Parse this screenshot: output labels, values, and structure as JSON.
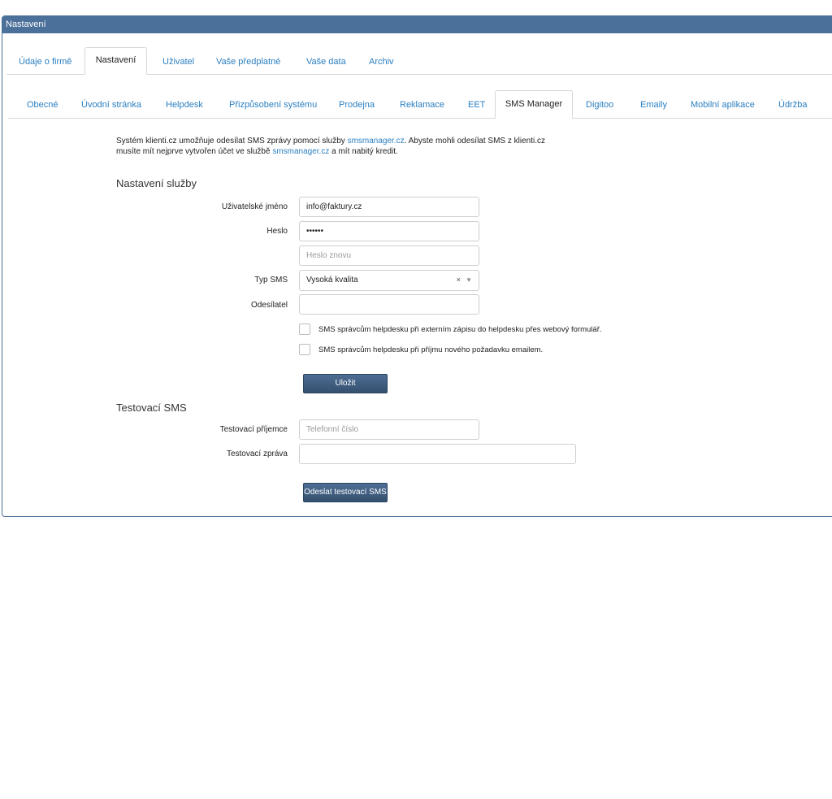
{
  "window": {
    "title": "Nastavení"
  },
  "main_tabs": [
    {
      "label": "Údaje o firmě"
    },
    {
      "label": "Nastavení"
    },
    {
      "label": "Uživatel"
    },
    {
      "label": "Vaše předplatné"
    },
    {
      "label": "Vaše data"
    },
    {
      "label": "Archiv"
    }
  ],
  "sub_tabs": [
    {
      "label": "Obecné"
    },
    {
      "label": "Úvodní stránka"
    },
    {
      "label": "Helpdesk"
    },
    {
      "label": "Přizpůsobení systému"
    },
    {
      "label": "Prodejna"
    },
    {
      "label": "Reklamace"
    },
    {
      "label": "EET"
    },
    {
      "label": "SMS Manager"
    },
    {
      "label": "Digitoo"
    },
    {
      "label": "Emaily"
    },
    {
      "label": "Mobilní aplikace"
    },
    {
      "label": "Údržba"
    }
  ],
  "intro": {
    "part1": "Systém klienti.cz umožňuje odesílat SMS zprávy pomocí služby ",
    "link1": "smsmanager.cz",
    "part2": ". Abyste mohli odesílat SMS z klienti.cz",
    "part3": "musíte mít nejprve vytvořen účet ve službě ",
    "link2": "smsmanager.cz",
    "part4": " a mít nabitý kredit."
  },
  "service": {
    "title": "Nastavení služby",
    "username_label": "Uživatelské jméno",
    "username_value": "info@faktury.cz",
    "password_label": "Heslo",
    "password_value": "••••••",
    "password_again_placeholder": "Heslo znovu",
    "type_label": "Typ SMS",
    "type_value": "Vysoká kvalita",
    "type_clear": "×",
    "type_caret": "▼",
    "sender_label": "Odesílatel",
    "sender_value": "",
    "checkbox1_label": "SMS správcům helpdesku při externím zápisu do helpdesku přes webový formulář.",
    "checkbox2_label": "SMS správcům helpdesku při příjmu nového požadavku emailem.",
    "save_label": "Uložit"
  },
  "test": {
    "title": "Testovací SMS",
    "recipient_label": "Testovací příjemce",
    "recipient_placeholder": "Telefonní číslo",
    "message_label": "Testovací zpráva",
    "message_value": "",
    "send_label": "Odeslat testovací SMS"
  }
}
